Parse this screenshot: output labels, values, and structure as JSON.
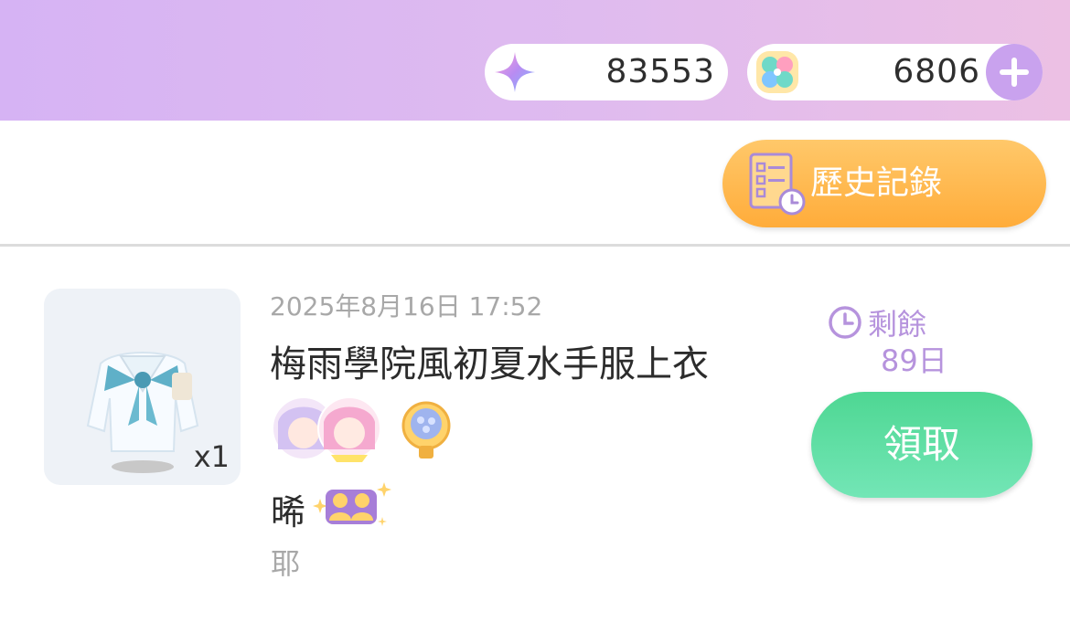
{
  "currency": {
    "stars": {
      "icon": "sparkle-star-icon",
      "value": "83553"
    },
    "clovers": {
      "icon": "clover-icon",
      "value": "6806",
      "add_icon": "plus-icon"
    }
  },
  "history_button": {
    "label": "歷史記錄",
    "icon": "history-list-clock-icon"
  },
  "mail_item": {
    "item_icon": "sailor-top-icon",
    "quantity": "x1",
    "date": "2025年8月16日 17:52",
    "title": "梅雨學院風初夏水手服上衣",
    "sender_name": "晞",
    "sender_emoji": "sparkle-friends-icon",
    "note": "耶",
    "remaining_label": "剩餘",
    "remaining_value": "89日",
    "claim_label": "領取"
  },
  "colors": {
    "accent_purple": "#c9a2ee",
    "claim_green": "#4ed793",
    "history_orange": "#ffac3a",
    "remaining_text": "#b693dd"
  }
}
